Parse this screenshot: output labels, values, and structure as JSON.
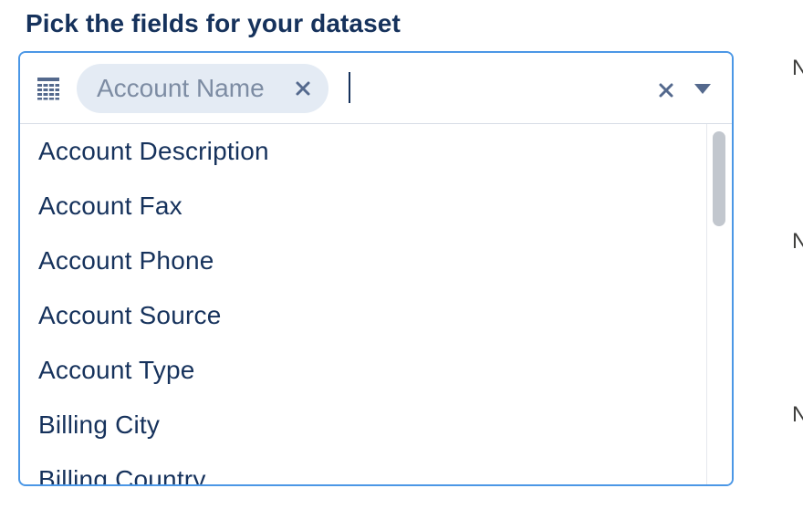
{
  "title": "Pick the fields for your dataset",
  "combobox": {
    "icon": "table-fields-icon",
    "selected_pill": {
      "label": "Account Name",
      "remove_icon": "close-icon"
    },
    "input_value": "",
    "clear_icon": "close-icon",
    "dropdown_icon": "caret-down-icon"
  },
  "options": [
    "Account Description",
    "Account Fax",
    "Account Phone",
    "Account Source",
    "Account Type",
    "Billing City",
    "Billing Country"
  ],
  "side_labels": [
    "N",
    "N",
    "N"
  ],
  "colors": {
    "title": "#16325c",
    "focus_border": "#4b97e6",
    "pill_bg": "#e4ebf4",
    "pill_text": "#7d8ca3",
    "icon": "#54698d",
    "scroll_thumb": "#c2c7ce"
  }
}
